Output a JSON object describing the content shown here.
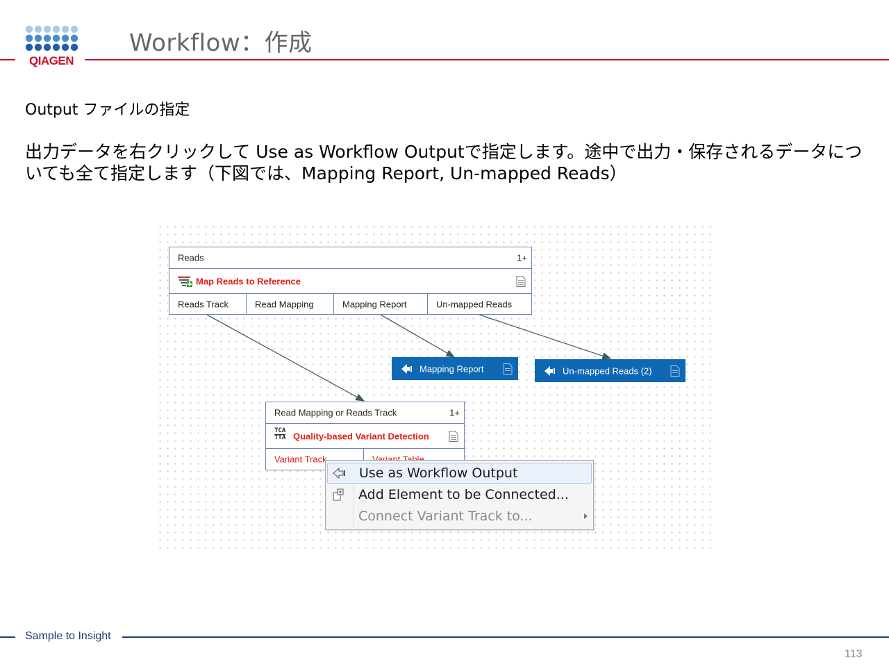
{
  "header": {
    "logo_text": "QIAGEN",
    "title": "Workflow：作成"
  },
  "content": {
    "subtitle": "Output ファイルの指定",
    "description": "出力データを右クリックして Use as Workflow Outputで指定します。途中で出力・保存されるデータについても全て指定します（下図では、Mapping Report, Un-mapped Reads）"
  },
  "workflow": {
    "map_node": {
      "input_label": "Reads",
      "input_badge": "1+",
      "tool_name": "Map Reads to Reference",
      "outputs": [
        "Reads Track",
        "Read Mapping",
        "Mapping Report",
        "Un-mapped Reads"
      ]
    },
    "output_mapping_report": {
      "label": "Mapping Report"
    },
    "output_unmapped": {
      "label": "Un-mapped Reads (2)"
    },
    "variant_node": {
      "input_label": "Read Mapping or Reads Track",
      "input_badge": "1+",
      "tool_name": "Quality-based Variant Detection",
      "tool_icon_top": "TCA",
      "tool_icon_bottom": "TTA",
      "outputs": [
        "Variant Track",
        "Variant Table"
      ]
    }
  },
  "context_menu": {
    "items": [
      {
        "label": "Use as Workflow Output",
        "highlighted": true,
        "enabled": true
      },
      {
        "label": "Add Element to be Connected...",
        "highlighted": false,
        "enabled": true
      },
      {
        "label": "Connect Variant Track to...",
        "highlighted": false,
        "enabled": false,
        "submenu": true
      }
    ]
  },
  "footer": {
    "tagline": "Sample to Insight",
    "page_number": "113"
  },
  "colors": {
    "brand_red": "#c8102e",
    "brand_navy": "#223a6e",
    "output_blue": "#0f68b4",
    "tool_red": "#e0211b",
    "node_border": "#6b84b4"
  }
}
